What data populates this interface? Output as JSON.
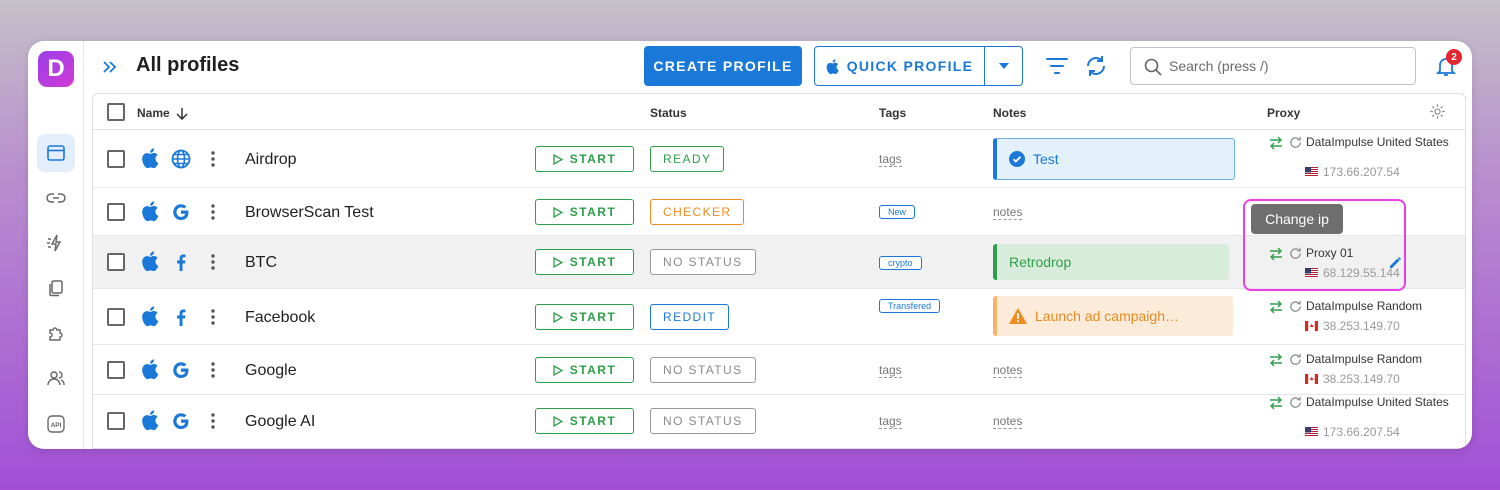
{
  "app": {
    "logo_letter": "D",
    "brand_color": "#1a78d8"
  },
  "header": {
    "title": "All profiles",
    "create_label": "CREATE PROFILE",
    "quick_label": "QUICK PROFILE",
    "search_placeholder": "Search (press /)",
    "notification_count": "2"
  },
  "sidebar": {
    "items": [
      {
        "icon": "browser-window-icon",
        "active": true
      },
      {
        "icon": "link-icon"
      },
      {
        "icon": "automation-icon"
      },
      {
        "icon": "copy-icon"
      },
      {
        "icon": "extension-icon"
      },
      {
        "icon": "users-icon"
      },
      {
        "icon": "api-icon",
        "text": "API"
      }
    ]
  },
  "table": {
    "columns": {
      "name": "Name",
      "status": "Status",
      "tags": "Tags",
      "notes": "Notes",
      "proxy": "Proxy"
    },
    "start_label": "START",
    "tags_placeholder": "tags",
    "notes_placeholder": "notes",
    "rows": [
      {
        "os": "apple-icon",
        "browser": "globe-icon",
        "name": "Airdrop",
        "status": "READY",
        "tag": "",
        "note": "Test",
        "proxy": "DataImpulse United States",
        "flag": "US",
        "ip": "173.66.207.54"
      },
      {
        "os": "apple-icon",
        "browser": "google-icon",
        "name": "BrowserScan Test",
        "status": "CHECKER",
        "tag": "New",
        "note": "",
        "proxy": "",
        "flag": "",
        "ip": ""
      },
      {
        "os": "apple-icon",
        "browser": "facebook-icon",
        "name": "BTC",
        "status": "NO STATUS",
        "tag": "crypto",
        "note": "Retrodrop",
        "proxy": "Proxy 01",
        "flag": "US",
        "ip": "68.129.55.144"
      },
      {
        "os": "apple-icon",
        "browser": "facebook-icon",
        "name": "Facebook",
        "status": "REDDIT",
        "tag": "Transfered",
        "note": "Launch ad campaigh…",
        "proxy": "DataImpulse Random",
        "flag": "CA",
        "ip": "38.253.149.70"
      },
      {
        "os": "apple-icon",
        "browser": "google-icon",
        "name": "Google",
        "status": "NO STATUS",
        "tag": "",
        "note": "",
        "proxy": "DataImpulse Random",
        "flag": "CA",
        "ip": "38.253.149.70"
      },
      {
        "os": "apple-icon",
        "browser": "google-icon",
        "name": "Google AI",
        "status": "NO STATUS",
        "tag": "",
        "note": "",
        "proxy": "DataImpulse United States",
        "flag": "US",
        "ip": "173.66.207.54"
      }
    ]
  },
  "tooltip": {
    "text": "Change ip"
  }
}
